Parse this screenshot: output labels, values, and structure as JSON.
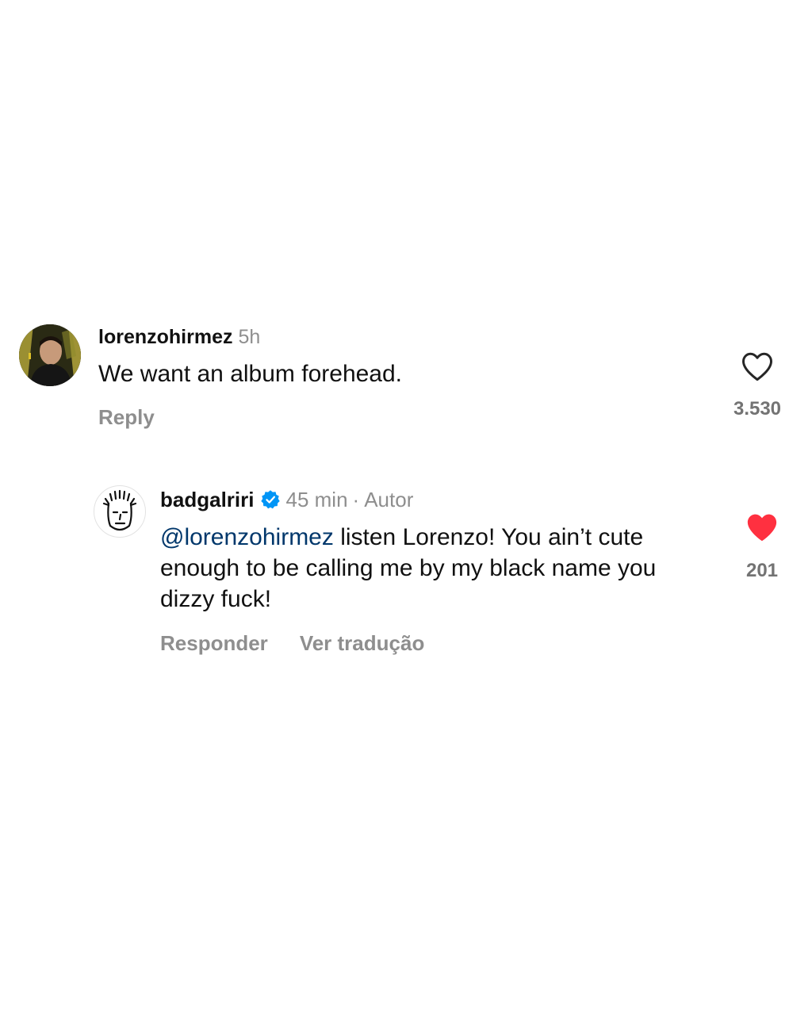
{
  "comments": [
    {
      "username": "lorenzohirmez",
      "time": "5h",
      "text": "We want an album forehead.",
      "reply_label": "Reply",
      "like_count": "3.530",
      "liked": false,
      "avatar_icon": "profile-photo"
    },
    {
      "username": "badgalriri",
      "verified": true,
      "verified_icon": "verified-badge-icon",
      "time": "45 min",
      "separator": "·",
      "author_label": "Autor",
      "mention": "@lorenzohirmez",
      "text": " listen Lorenzo! You ain’t cute enough to be calling me by my black name you dizzy fuck!",
      "reply_label": "Responder",
      "translate_label": "Ver tradução",
      "like_count": "201",
      "liked": true,
      "avatar_icon": "doodle-face-avatar"
    }
  ],
  "colors": {
    "meta_gray": "#8e8e8e",
    "mention_blue": "#00376b",
    "verified_blue": "#0095f6",
    "like_red": "#ff3040"
  }
}
